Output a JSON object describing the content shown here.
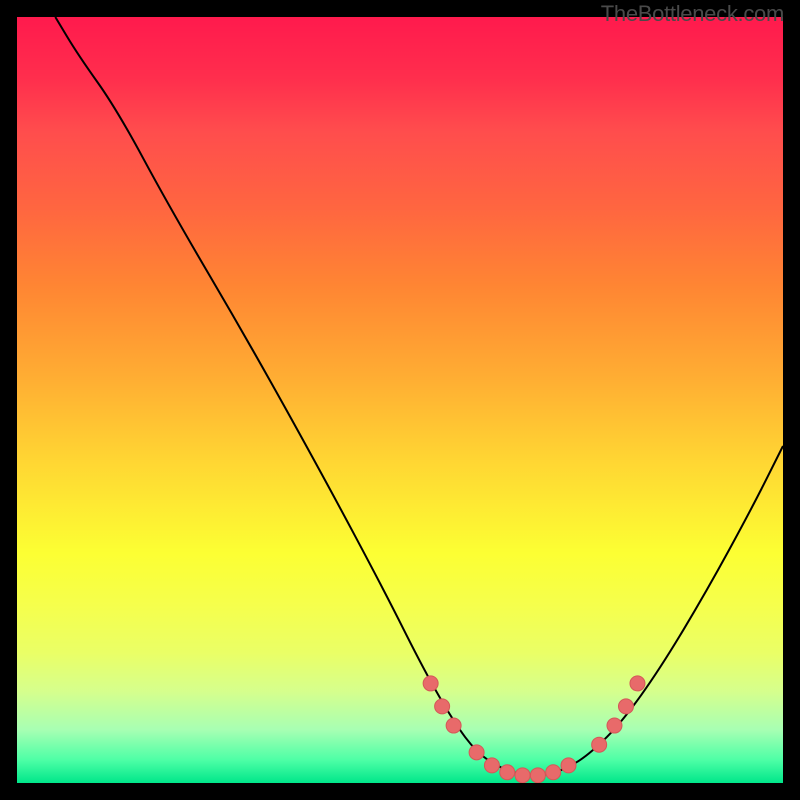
{
  "watermark": "TheBottleneck.com",
  "chart_data": {
    "type": "line",
    "title": "",
    "xlabel": "",
    "ylabel": "",
    "xlim": [
      0,
      100
    ],
    "ylim": [
      0,
      100
    ],
    "curve": {
      "name": "bottleneck-curve",
      "points": [
        {
          "x": 5,
          "y": 100
        },
        {
          "x": 8,
          "y": 95
        },
        {
          "x": 13,
          "y": 88
        },
        {
          "x": 20,
          "y": 75
        },
        {
          "x": 30,
          "y": 58
        },
        {
          "x": 40,
          "y": 40
        },
        {
          "x": 48,
          "y": 25
        },
        {
          "x": 53,
          "y": 15
        },
        {
          "x": 57,
          "y": 8
        },
        {
          "x": 60,
          "y": 4
        },
        {
          "x": 63,
          "y": 2
        },
        {
          "x": 66,
          "y": 1
        },
        {
          "x": 69,
          "y": 1
        },
        {
          "x": 72,
          "y": 2
        },
        {
          "x": 75,
          "y": 4
        },
        {
          "x": 79,
          "y": 8
        },
        {
          "x": 84,
          "y": 15
        },
        {
          "x": 90,
          "y": 25
        },
        {
          "x": 96,
          "y": 36
        },
        {
          "x": 100,
          "y": 44
        }
      ]
    },
    "markers": {
      "name": "highlighted-points",
      "color": "#e86a6a",
      "points": [
        {
          "x": 54,
          "y": 13
        },
        {
          "x": 55.5,
          "y": 10
        },
        {
          "x": 57,
          "y": 7.5
        },
        {
          "x": 60,
          "y": 4
        },
        {
          "x": 62,
          "y": 2.3
        },
        {
          "x": 64,
          "y": 1.4
        },
        {
          "x": 66,
          "y": 1
        },
        {
          "x": 68,
          "y": 1
        },
        {
          "x": 70,
          "y": 1.4
        },
        {
          "x": 72,
          "y": 2.3
        },
        {
          "x": 76,
          "y": 5
        },
        {
          "x": 78,
          "y": 7.5
        },
        {
          "x": 79.5,
          "y": 10
        },
        {
          "x": 81,
          "y": 13
        }
      ]
    }
  }
}
